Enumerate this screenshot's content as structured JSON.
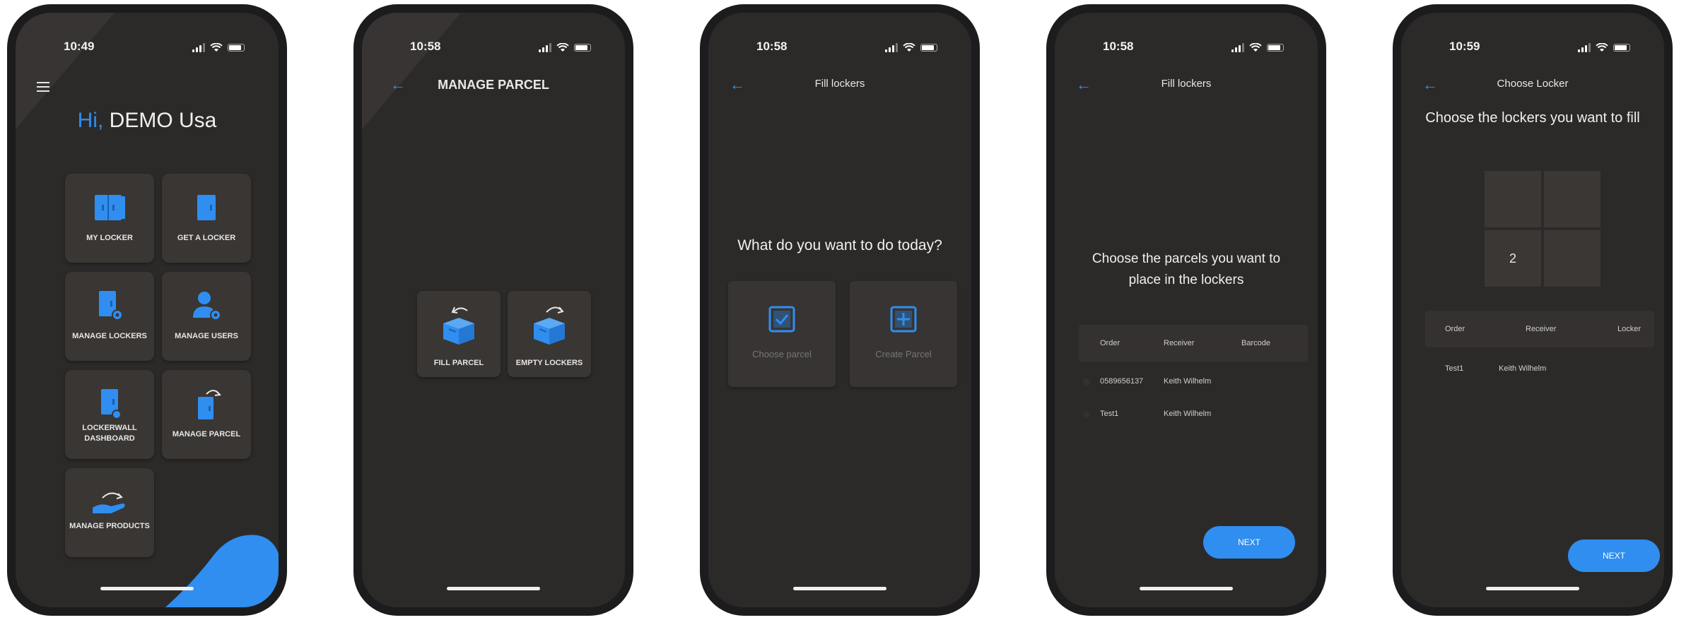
{
  "accent": "#2f8ef0",
  "status_times": [
    "10:49",
    "10:58",
    "10:58",
    "10:58",
    "10:59"
  ],
  "home": {
    "greeting_hi": "Hi,",
    "greeting_name": "DEMO Usa",
    "tiles": [
      "MY LOCKER",
      "GET A LOCKER",
      "MANAGE LOCKERS",
      "MANAGE USERS",
      "LOCKERWALL DASHBOARD",
      "MANAGE PARCEL",
      "MANAGE PRODUCTS"
    ],
    "icons": [
      "double-locker-icon",
      "locker-icon",
      "locker-gear-icon",
      "user-gear-icon",
      "locker-dashboard-icon",
      "locker-arrow-icon",
      "hand-arrow-icon"
    ]
  },
  "manage_parcel": {
    "title": "MANAGE PARCEL",
    "options": [
      "FILL PARCEL",
      "EMPTY LOCKERS"
    ]
  },
  "fill_lockers_1": {
    "title": "Fill lockers",
    "question": "What do you want to do today?",
    "options": [
      "Choose parcel",
      "Create Parcel"
    ]
  },
  "fill_lockers_2": {
    "title": "Fill lockers",
    "prompt": "Choose the parcels you want to place in the lockers",
    "columns": [
      "Order",
      "Receiver",
      "Barcode"
    ],
    "rows": [
      {
        "order": "0589656137",
        "receiver": "Keith Wilhelm",
        "barcode": ""
      },
      {
        "order": "Test1",
        "receiver": "Keith Wilhelm",
        "barcode": ""
      }
    ],
    "next_label": "NEXT"
  },
  "choose_locker": {
    "title": "Choose Locker",
    "prompt": "Choose the lockers you want to fill",
    "lockers": [
      "",
      "",
      "2",
      ""
    ],
    "columns": [
      "Order",
      "Receiver",
      "Locker"
    ],
    "rows": [
      {
        "order": "Test1",
        "receiver": "Keith Wilhelm",
        "locker": ""
      }
    ],
    "next_label": "NEXT"
  }
}
